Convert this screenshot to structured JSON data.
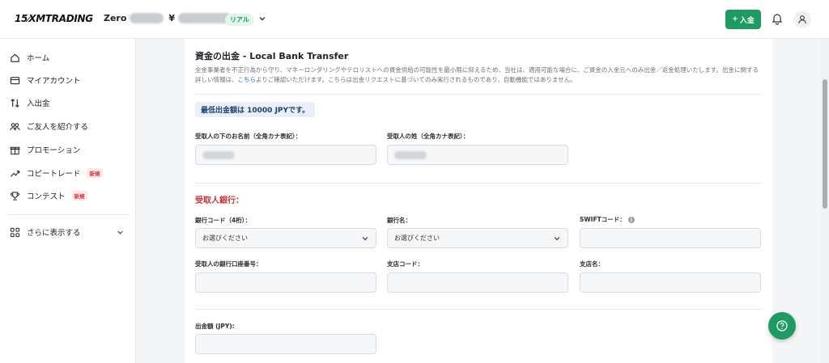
{
  "header": {
    "logo_prefix": "15",
    "logo_text": "XMTRADING",
    "account_type": "Zero",
    "currency_symbol": "¥",
    "account_badge": "リアル",
    "deposit_label": "入金",
    "deposit_plus": "+"
  },
  "sidebar": {
    "items": [
      {
        "label": "ホーム",
        "icon": "home-icon"
      },
      {
        "label": "マイアカウント",
        "icon": "wallet-icon"
      },
      {
        "label": "入出金",
        "icon": "transfer-icon"
      },
      {
        "label": "ご友人を紹介する",
        "icon": "people-icon"
      },
      {
        "label": "プロモーション",
        "icon": "gift-icon"
      },
      {
        "label": "コピートレード",
        "icon": "trend-icon",
        "tag": "新規"
      },
      {
        "label": "コンテスト",
        "icon": "trophy-icon",
        "tag": "新規"
      }
    ],
    "more_label": "さらに表示する"
  },
  "main": {
    "title": "資金の出金 - Local Bank Transfer",
    "desc_before": "全金事業者を不正行為から守り、マネーロンダリングやテロリストへの資金供給の可能性を最小限に抑えるため、当社は、適用可能な場合に、ご資金の入金元へのみ出金／返金処理いたします。出金に関する詳しい情報は、",
    "desc_link": "こちら",
    "desc_after": "よりご確認いただけます。こちらは出金リクエストに基づいてのみ実行されるものであり、自動機能ではありません。",
    "min_note": "最低出金額は 10000 JPYです。",
    "first_name_label": "受取人の下のお名前（全角カナ表記）：",
    "last_name_label": "受取人の姓（全角カナ表記）：",
    "bank_section": "受取人銀行：",
    "bank_code_label": "銀行コード（4桁）：",
    "bank_name_label": "銀行名：",
    "swift_label": "SWIFTコード：",
    "select_placeholder": "お選びください",
    "account_no_label": "受取人の銀行口座番号：",
    "branch_code_label": "支店コード：",
    "branch_name_label": "支店名：",
    "amount_label": "出金額 (JPY):"
  },
  "colors": {
    "accent": "#1e9b63",
    "danger": "#c8323a",
    "link": "#1a6fd1"
  }
}
